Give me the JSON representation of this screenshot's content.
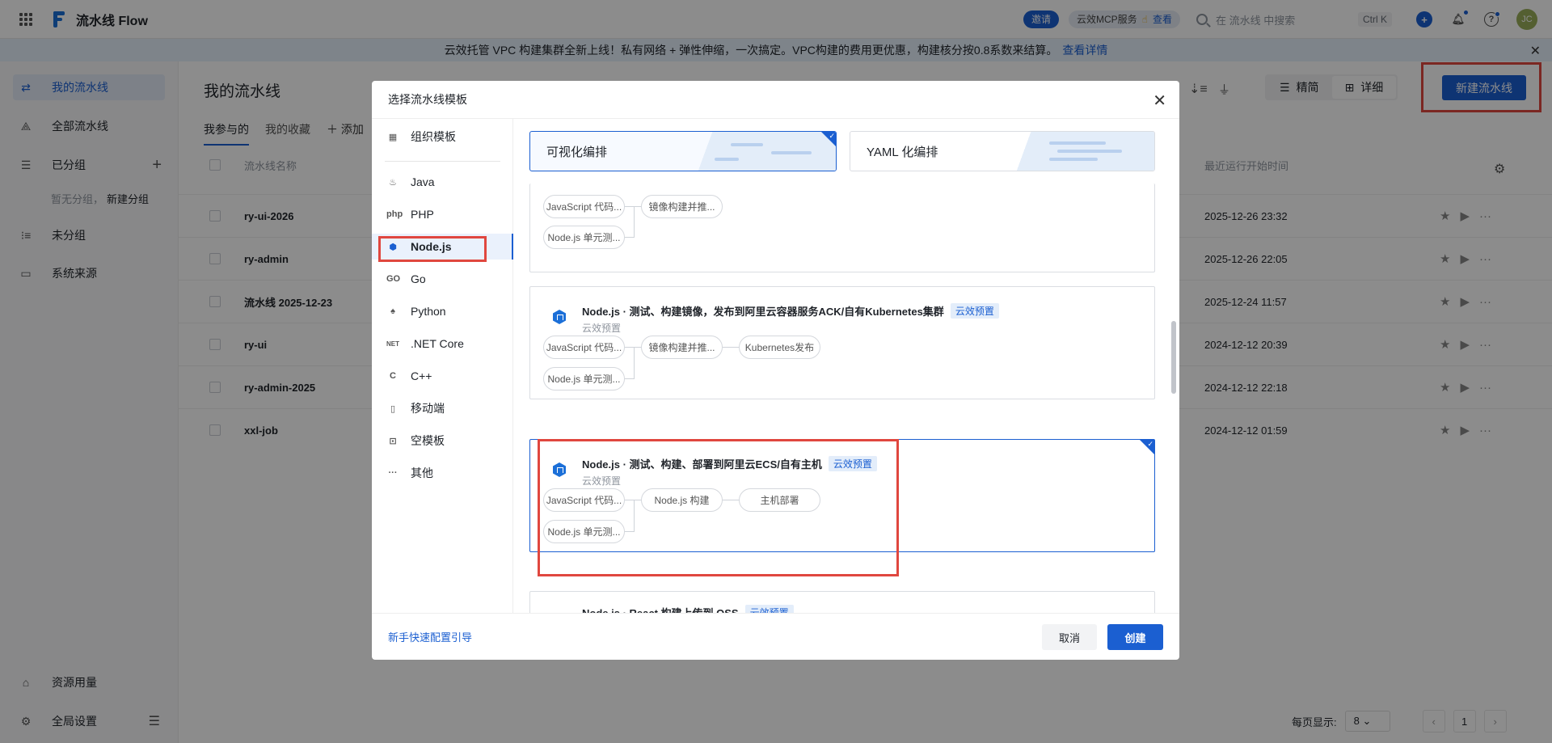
{
  "topbar": {
    "app_title": "流水线 Flow",
    "invite": "邀请",
    "mcp_label": "云效MCP服务",
    "mcp_view": "查看",
    "search_placeholder": "在 流水线 中搜索",
    "shortcut": "Ctrl K",
    "avatar_text": "JC"
  },
  "banner": {
    "text": "云效托管 VPC 构建集群全新上线！私有网络 + 弹性伸缩，一次搞定。VPC构建的费用更优惠，构建核分按0.8系数来结算。",
    "link": "查看详情"
  },
  "sidebar": {
    "items": [
      {
        "label": "我的流水线",
        "icon": "pipeline-icon"
      },
      {
        "label": "全部流水线",
        "icon": "all-pipelines-icon"
      },
      {
        "label": "已分组",
        "icon": "group-icon"
      },
      {
        "label": "未分组",
        "icon": "ungrouped-icon"
      },
      {
        "label": "系统来源",
        "icon": "system-source-icon"
      }
    ],
    "empty_group": "暂无分组，",
    "new_group": "新建分组",
    "resource_usage": "资源用量",
    "global_settings": "全局设置"
  },
  "main": {
    "title": "我的流水线",
    "tabs": [
      "我参与的",
      "我的收藏",
      "添加"
    ],
    "view_simple": "精简",
    "view_detail": "详细",
    "new_pipeline": "新建流水线",
    "col_name": "流水线名称",
    "col_time": "最近运行开始时间",
    "rows": [
      {
        "name": "ry-ui-2026",
        "time": "2025-12-26 23:32"
      },
      {
        "name": "ry-admin",
        "time": "2025-12-26 22:05"
      },
      {
        "name": "流水线 2025-12-23",
        "time": "2025-12-24 11:57"
      },
      {
        "name": "ry-ui",
        "time": "2024-12-12 20:39"
      },
      {
        "name": "ry-admin-2025",
        "time": "2024-12-12 22:18"
      },
      {
        "name": "xxl-job",
        "time": "2024-12-12 01:59"
      }
    ],
    "pager_label": "每页显示:",
    "page_size": "8",
    "current_page": "1"
  },
  "modal": {
    "title": "选择流水线模板",
    "categories": [
      {
        "label": "组织模板",
        "icon": "▦"
      },
      {
        "label": "Java",
        "icon": "♨"
      },
      {
        "label": "PHP",
        "icon": "php"
      },
      {
        "label": "Node.js",
        "icon": "⬢"
      },
      {
        "label": "Go",
        "icon": "GO"
      },
      {
        "label": "Python",
        "icon": "♠"
      },
      {
        "label": ".NET Core",
        "icon": "NET"
      },
      {
        "label": "C++",
        "icon": "C"
      },
      {
        "label": "移动端",
        "icon": "▯"
      },
      {
        "label": "空模板",
        "icon": "⊡"
      },
      {
        "label": "其他",
        "icon": "···"
      }
    ],
    "mode_visual": "可视化编排",
    "mode_yaml": "YAML 化编排",
    "templates": [
      {
        "title": "Node.js · 测试、构建镜像，发布到阿里云容器服务ACK/自有Kubernetes集群",
        "tag": "云效预置",
        "sub": "云效预置",
        "nodes": [
          "JavaScript 代码...",
          "Node.js 单元测...",
          "镜像构建并推...",
          "Kubernetes发布"
        ]
      },
      {
        "title": "Node.js · 测试、构建、部署到阿里云ECS/自有主机",
        "tag": "云效预置",
        "sub": "云效预置",
        "nodes": [
          "JavaScript 代码...",
          "Node.js 单元测...",
          "Node.js 构建",
          "主机部署"
        ]
      },
      {
        "title": "Node.js · React 构建上传到 OSS",
        "tag": "云效预置"
      }
    ],
    "top_nodes": [
      "JavaScript 代码...",
      "Node.js 单元测...",
      "镜像构建并推..."
    ],
    "guide": "新手快速配置引导",
    "cancel": "取消",
    "create": "创建"
  }
}
